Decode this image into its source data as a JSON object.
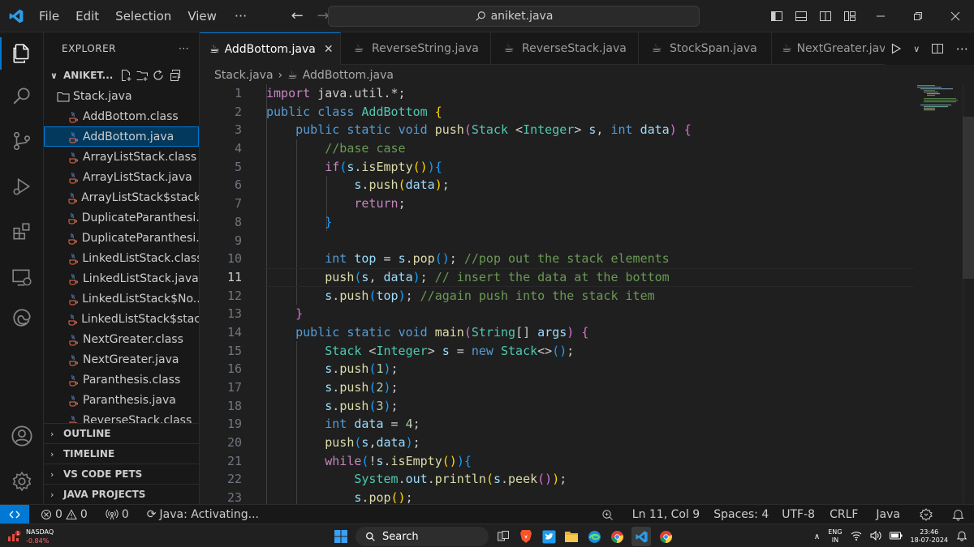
{
  "titlebar": {
    "menu": [
      "File",
      "Edit",
      "Selection",
      "View"
    ],
    "more": "···",
    "search_text": "aniket.java"
  },
  "explorer": {
    "title": "EXPLORER",
    "more": "···",
    "folder_name": "ANIKET...",
    "top_file": "Stack.java",
    "files": [
      "AddBottom.class",
      "AddBottom.java",
      "ArrayListStack.class",
      "ArrayListStack.java",
      "ArrayListStack$stack...",
      "DuplicateParanthesi...",
      "DuplicateParanthesi...",
      "LinkedListStack.class",
      "LinkedListStack.java",
      "LinkedListStack$No...",
      "LinkedListStack$stac...",
      "NextGreater.class",
      "NextGreater.java",
      "Paranthesis.class",
      "Paranthesis.java",
      "ReverseStack.class"
    ],
    "selected_index": 1,
    "sections": [
      "OUTLINE",
      "TIMELINE",
      "VS CODE PETS",
      "JAVA PROJECTS"
    ]
  },
  "tabs": [
    "AddBottom.java",
    "ReverseString.java",
    "ReverseStack.java",
    "StockSpan.java",
    "NextGreater.jav"
  ],
  "active_tab": "AddBottom.java",
  "breadcrumb": [
    "Stack.java",
    "AddBottom.java"
  ],
  "editor": {
    "line_numbers": [
      "1",
      "2",
      "3",
      "4",
      "5",
      "6",
      "7",
      "8",
      "9",
      "10",
      "11",
      "12",
      "13",
      "14",
      "15",
      "16",
      "17",
      "18",
      "19",
      "20",
      "21",
      "22",
      "23"
    ],
    "current_line": 11
  },
  "status": {
    "errors": "0",
    "warnings": "0",
    "ports": "0",
    "java_status": "Java: Activating...",
    "position": "Ln 11, Col 9",
    "spaces": "Spaces: 4",
    "encoding": "UTF-8",
    "eol": "CRLF",
    "language": "Java"
  },
  "taskbar": {
    "stock_name": "NASDAQ",
    "stock_change": "-0.84%",
    "search_label": "Search",
    "lang_top": "ENG",
    "lang_bottom": "IN",
    "time": "23:46",
    "date": "18-07-2024"
  }
}
